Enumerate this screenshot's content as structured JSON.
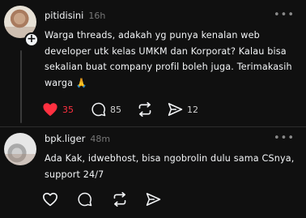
{
  "posts": [
    {
      "username": "pitidisini",
      "time": "16h",
      "lines": [
        "Warga threads, adakah yg punya kenalan web",
        "developer utk kelas UMKM dan Korporat? Kalau bisa",
        "sekalian buat company profil boleh juga. Terimakasih",
        "warga 🙏"
      ],
      "follow_label": "+",
      "liked": true,
      "likes": "35",
      "replies": "85",
      "reposts": "",
      "shares": "12"
    },
    {
      "username": "bpk.liger",
      "time": "48m",
      "lines": [
        "Ada Kak, idwebhost, bisa ngobrolin dulu sama CSnya,",
        "support 24/7"
      ],
      "liked": false,
      "likes": "",
      "replies": "",
      "reposts": "",
      "shares": ""
    }
  ],
  "more_label": "•••",
  "colors": {
    "background": "#101010",
    "text": "#f3f5f7",
    "muted": "#777777",
    "like_active": "#ff3040"
  },
  "icons": [
    "heart-icon",
    "comment-icon",
    "repost-icon",
    "share-icon",
    "more-icon",
    "plus-icon"
  ]
}
